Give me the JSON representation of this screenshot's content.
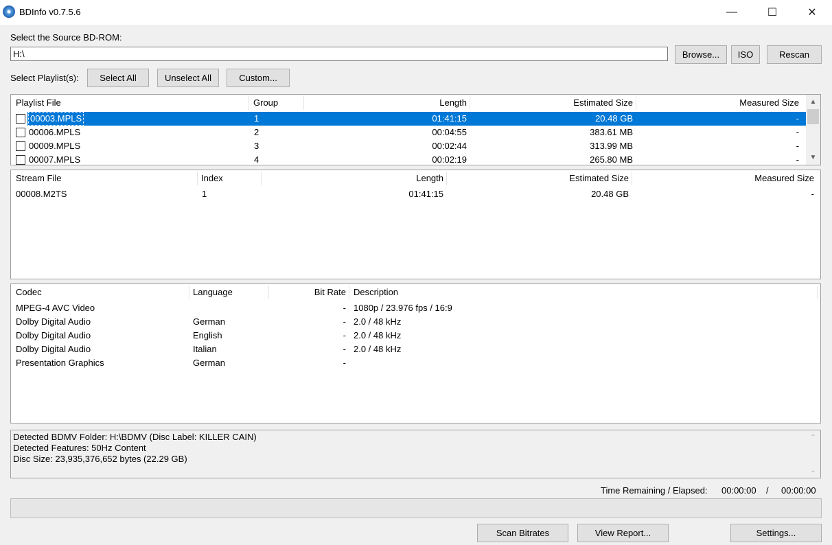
{
  "window": {
    "title": "BDInfo v0.7.5.6",
    "minimize_glyph": "—",
    "maximize_glyph": "☐",
    "close_glyph": "✕"
  },
  "source": {
    "label": "Select the Source BD-ROM:",
    "path_value": "H:\\",
    "browse_label": "Browse...",
    "iso_label": "ISO",
    "rescan_label": "Rescan"
  },
  "playlist_controls": {
    "label": "Select Playlist(s):",
    "select_all_label": "Select All",
    "unselect_all_label": "Unselect All",
    "custom_label": "Custom..."
  },
  "playlists": {
    "columns": [
      "Playlist File",
      "Group",
      "Length",
      "Estimated Size",
      "Measured Size"
    ],
    "rows": [
      {
        "file": "00003.MPLS",
        "group": "1",
        "length": "01:41:15",
        "estimated": "20.48 GB",
        "measured": "-",
        "selected": true
      },
      {
        "file": "00006.MPLS",
        "group": "2",
        "length": "00:04:55",
        "estimated": "383.61 MB",
        "measured": "-",
        "selected": false
      },
      {
        "file": "00009.MPLS",
        "group": "3",
        "length": "00:02:44",
        "estimated": "313.99 MB",
        "measured": "-",
        "selected": false
      },
      {
        "file": "00007.MPLS",
        "group": "4",
        "length": "00:02:19",
        "estimated": "265.80 MB",
        "measured": "-",
        "selected": false
      }
    ]
  },
  "streams": {
    "columns": [
      "Stream File",
      "Index",
      "Length",
      "Estimated Size",
      "Measured Size"
    ],
    "rows": [
      {
        "file": "00008.M2TS",
        "index": "1",
        "length": "01:41:15",
        "estimated": "20.48 GB",
        "measured": "-"
      }
    ]
  },
  "codecs": {
    "columns": [
      "Codec",
      "Language",
      "Bit Rate",
      "Description"
    ],
    "rows": [
      {
        "codec": "MPEG-4 AVC Video",
        "language": "",
        "bitrate": "-",
        "description": "1080p / 23.976 fps / 16:9"
      },
      {
        "codec": "Dolby Digital Audio",
        "language": "German",
        "bitrate": "-",
        "description": "2.0 / 48 kHz"
      },
      {
        "codec": "Dolby Digital Audio",
        "language": "English",
        "bitrate": "-",
        "description": "2.0 / 48 kHz"
      },
      {
        "codec": "Dolby Digital Audio",
        "language": "Italian",
        "bitrate": "-",
        "description": "2.0 / 48 kHz"
      },
      {
        "codec": "Presentation Graphics",
        "language": "German",
        "bitrate": "-",
        "description": ""
      }
    ]
  },
  "status": {
    "lines": [
      "Detected BDMV Folder: H:\\BDMV (Disc Label: KILLER CAIN)",
      "Detected Features: 50Hz Content",
      "Disc Size: 23,935,376,652 bytes (22.29 GB)"
    ]
  },
  "timing": {
    "label": "Time Remaining / Elapsed:",
    "remaining": "00:00:00",
    "separator": "/",
    "elapsed": "00:00:00"
  },
  "progress": {
    "fraction": 0
  },
  "bottom_buttons": {
    "scan_label": "Scan Bitrates",
    "report_label": "View Report...",
    "settings_label": "Settings..."
  },
  "colors": {
    "selection": "#0078d7",
    "window_bg": "#f0f0f0"
  }
}
